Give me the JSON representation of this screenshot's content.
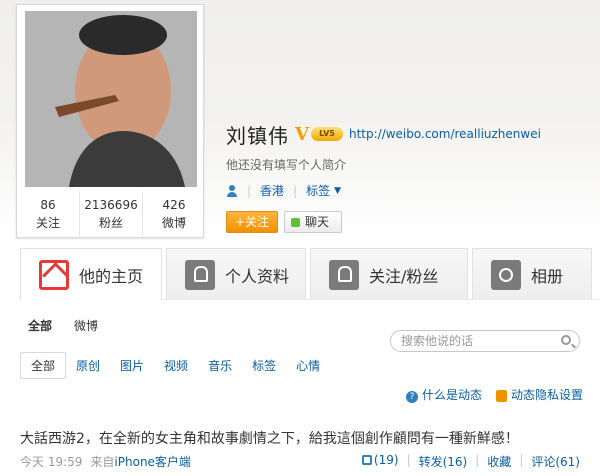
{
  "profile": {
    "name": "刘镇伟",
    "verified": "V",
    "level_badge": "LV5",
    "url": "http://weibo.com/realliuzhenwei",
    "bio": "他还没有填写个人简介",
    "location": "香港",
    "tags_label": "标签",
    "stats": [
      {
        "value": "86",
        "label": "关注"
      },
      {
        "value": "2136696",
        "label": "粉丝"
      },
      {
        "value": "426",
        "label": "微博"
      }
    ],
    "follow_button": "+关注",
    "chat_button": "聊天"
  },
  "tabs": [
    {
      "label": "他的主页",
      "icon": "home-icon",
      "active": true
    },
    {
      "label": "个人资料",
      "icon": "profile-icon"
    },
    {
      "label": "关注/粉丝",
      "icon": "follow-icon"
    },
    {
      "label": "相册",
      "icon": "camera-icon"
    }
  ],
  "feed": {
    "filter_primary": [
      "全部",
      "微博"
    ],
    "search_placeholder": "搜索他说的话",
    "filter_secondary": [
      "全部",
      "原创",
      "图片",
      "视频",
      "音乐",
      "标签",
      "心情"
    ],
    "help_link": "什么是动态",
    "privacy_link": "动态隐私设置",
    "post": {
      "text": "大話西游2，在全新的女主角和故事劇情之下，給我這個創作顧問有一種新鮮感！",
      "time": "今天 19:59",
      "source_prefix": "来自",
      "source": "iPhone客户端",
      "likes": "(19)",
      "repost": "转发(16)",
      "fav": "收藏",
      "comment": "评论(61)"
    }
  }
}
